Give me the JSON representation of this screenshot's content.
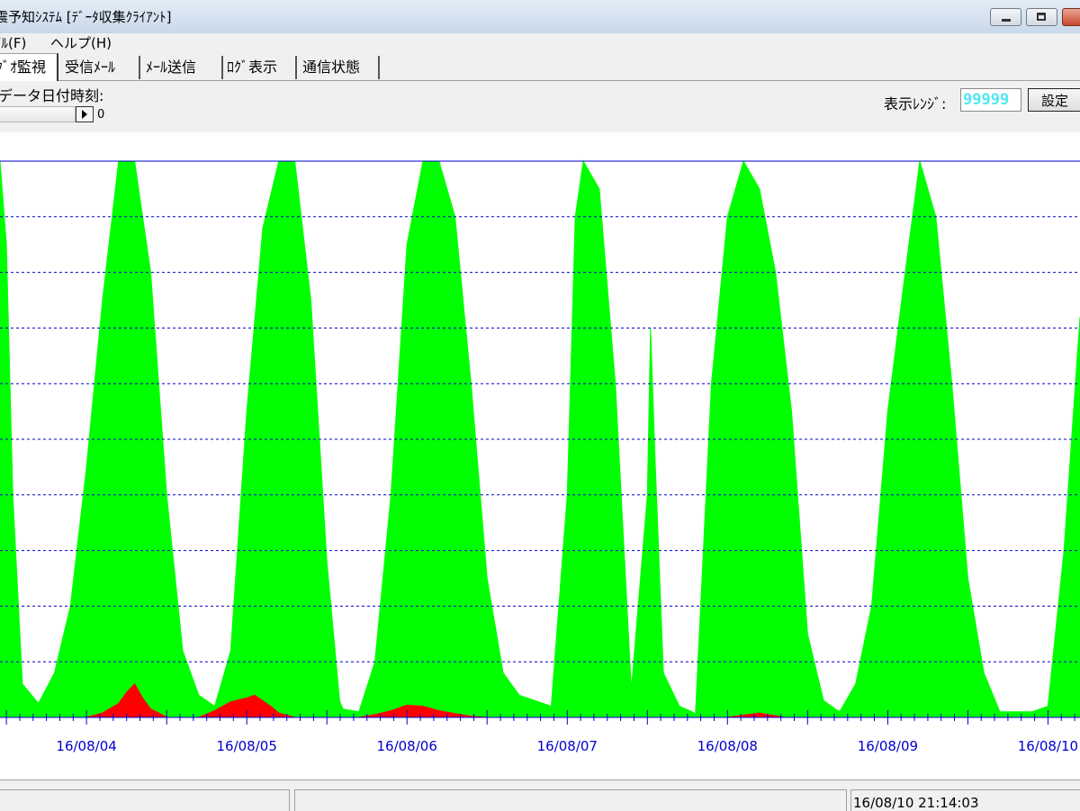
{
  "window": {
    "title": "震予知ｼｽﾃﾑ [ﾃﾞｰﾀ収集ｸﾗｲｱﾝﾄ]"
  },
  "menu": {
    "items": [
      {
        "label": "ｲﾙ(F)"
      },
      {
        "label": "ヘルプ(H)"
      }
    ]
  },
  "tabs": [
    {
      "label": "ｸﾞｵ監視",
      "active": true
    },
    {
      "label": "受信ﾒｰﾙ",
      "active": false
    },
    {
      "label": "ﾒｰﾙ送信",
      "active": false
    },
    {
      "label": "ﾛｸﾞ表示",
      "active": false
    },
    {
      "label": "通信状態",
      "active": false
    }
  ],
  "controls": {
    "datetime_label": "データ日付時刻:",
    "scroll_value": "0",
    "range_label": "表示ﾚﾝｼﾞ:",
    "range_value": "99999",
    "set_button": "設定"
  },
  "colors": {
    "series_main": "#00ff00",
    "series_secondary": "#ff0000",
    "grid": "#0000cc",
    "axis_labels": "#0000cc",
    "range_text": "#4ee8f2"
  },
  "chart_data": {
    "type": "area",
    "x_unit": "day",
    "x_ticks": [
      "16/08/04",
      "16/08/05",
      "16/08/06",
      "16/08/07",
      "16/08/08",
      "16/08/09",
      "16/08/10"
    ],
    "x_range": [
      3.96,
      10.7
    ],
    "y_range": [
      0,
      99999
    ],
    "grid": "horizontal dashed",
    "series": [
      {
        "color": "#00ff00",
        "x": [
          3.96,
          4.0,
          4.04,
          4.1,
          4.2,
          4.3,
          4.4,
          4.5,
          4.6,
          4.7,
          4.75,
          4.8,
          4.9,
          5.0,
          5.1,
          5.2,
          5.3,
          5.4,
          5.5,
          5.6,
          5.7,
          5.8,
          5.9,
          6.0,
          6.08,
          6.1,
          6.2,
          6.3,
          6.4,
          6.5,
          6.6,
          6.7,
          6.8,
          6.9,
          7.0,
          7.1,
          7.2,
          7.3,
          7.4,
          7.5,
          7.55,
          7.6,
          7.7,
          7.8,
          7.9,
          8.0,
          8.02,
          8.05,
          8.1,
          8.2,
          8.28,
          8.3,
          8.4,
          8.5,
          8.6,
          8.7,
          8.8,
          8.9,
          9.0,
          9.1,
          9.2,
          9.3,
          9.4,
          9.5,
          9.6,
          9.7,
          9.8,
          9.9,
          10.0,
          10.1,
          10.2,
          10.3,
          10.4,
          10.5,
          10.6,
          10.7
        ],
        "y": [
          100000,
          85000,
          40000,
          6000,
          2500,
          8000,
          20000,
          45000,
          75000,
          100000,
          100000,
          100000,
          80000,
          40000,
          12000,
          4000,
          2000,
          12000,
          55000,
          88000,
          100000,
          100000,
          75000,
          28000,
          3000,
          1500,
          1000,
          10000,
          40000,
          85000,
          100000,
          100000,
          90000,
          60000,
          25000,
          8000,
          4000,
          3000,
          2000,
          40000,
          90000,
          100000,
          95000,
          60000,
          5000,
          40000,
          70000,
          45000,
          8000,
          2000,
          1000,
          500,
          60000,
          90000,
          100000,
          95000,
          80000,
          55000,
          15000,
          3000,
          1000,
          6000,
          20000,
          55000,
          78000,
          100000,
          90000,
          60000,
          25000,
          8000,
          1000,
          1000,
          1000,
          2000,
          30000,
          72000
        ]
      },
      {
        "color": "#ff0000",
        "x": [
          4.5,
          4.6,
          4.7,
          4.75,
          4.8,
          4.85,
          4.9,
          4.95,
          5.0,
          5.2,
          5.3,
          5.4,
          5.5,
          5.55,
          5.6,
          5.65,
          5.7,
          5.8,
          6.2,
          6.3,
          6.4,
          6.5,
          6.6,
          6.7,
          6.8,
          6.9,
          7.0,
          7.1,
          7.2,
          8.5,
          8.6,
          8.7,
          8.75,
          8.8,
          8.85
        ],
        "y": [
          0,
          800,
          2500,
          4500,
          6000,
          3500,
          1500,
          800,
          0,
          0,
          1200,
          2800,
          3500,
          4000,
          3000,
          2000,
          800,
          0,
          0,
          500,
          1200,
          2200,
          2000,
          1200,
          700,
          200,
          0,
          0,
          0,
          0,
          400,
          800,
          500,
          300,
          0
        ]
      }
    ]
  },
  "status": {
    "timestamp": "16/08/10 21:14:03"
  }
}
